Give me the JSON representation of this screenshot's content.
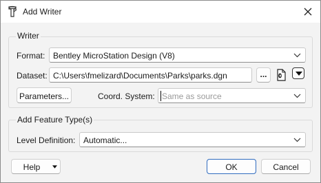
{
  "window": {
    "title": "Add Writer"
  },
  "writer_group": {
    "title": "Writer",
    "format_label": "Format:",
    "format_value": "Bentley MicroStation Design (V8)",
    "dataset_label": "Dataset:",
    "dataset_value": "C:\\Users\\fmelizard\\Documents\\Parks\\parks.dgn",
    "browse_label": "...",
    "parameters_label": "Parameters...",
    "coord_label": "Coord. System:",
    "coord_placeholder": "Same as source"
  },
  "feature_group": {
    "title": "Add Feature Type(s)",
    "level_label": "Level Definition:",
    "level_value": "Automatic..."
  },
  "footer": {
    "help_label": "Help",
    "ok_label": "OK",
    "cancel_label": "Cancel"
  },
  "colors": {
    "accent": "#2f6bbf",
    "window_bg": "#f3f3f3"
  },
  "icons": [
    "writer-app-icon",
    "close-icon",
    "chevron-down-icon",
    "file-icon",
    "dropdown-arrow-icon"
  ]
}
